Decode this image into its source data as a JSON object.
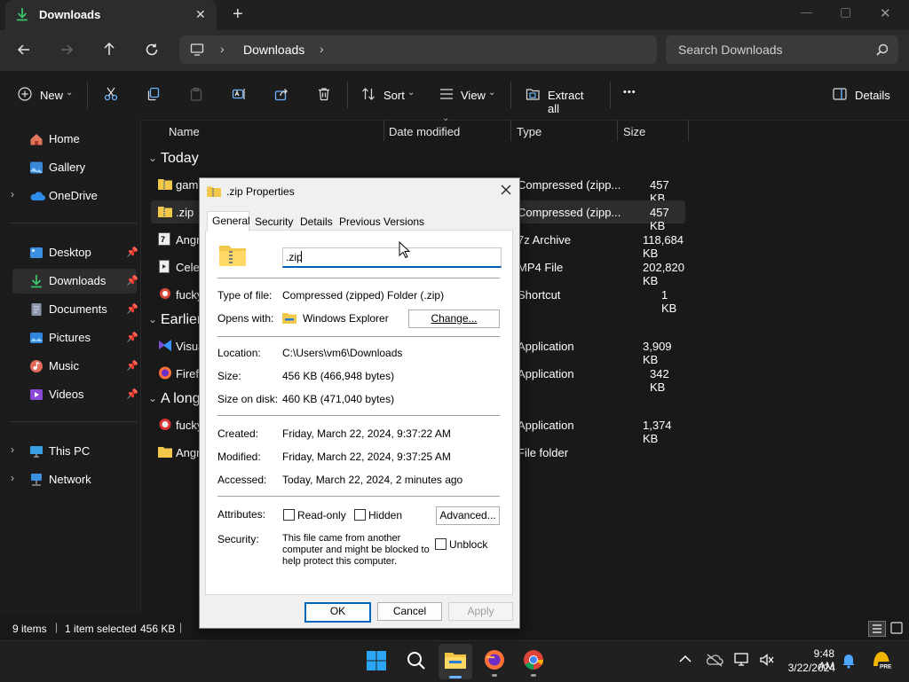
{
  "window": {
    "tab_title": "Downloads",
    "new_tab": "+",
    "controls": {
      "minimize": "—",
      "maximize": "▢",
      "close": "✕"
    }
  },
  "address": {
    "breadcrumb": "Downloads",
    "search_placeholder": "Search Downloads"
  },
  "toolbar": {
    "new": "New",
    "sort": "Sort",
    "view": "View",
    "extract_all": "Extract all",
    "more": "•••",
    "details": "Details"
  },
  "sidebar": {
    "home": "Home",
    "gallery": "Gallery",
    "onedrive": "OneDrive",
    "desktop": "Desktop",
    "downloads": "Downloads",
    "documents": "Documents",
    "pictures": "Pictures",
    "music": "Music",
    "videos": "Videos",
    "this_pc": "This PC",
    "network": "Network"
  },
  "columns": {
    "name": "Name",
    "date": "Date modified",
    "type": "Type",
    "size": "Size"
  },
  "groups": {
    "today": "Today",
    "earlier": "Earlier",
    "long_ago": "A long"
  },
  "files": [
    {
      "name": "gam",
      "type": "Compressed (zipp...",
      "size": "457 KB"
    },
    {
      "name": ".zip",
      "type": "Compressed (zipp...",
      "size": "457 KB"
    },
    {
      "name": "Angr",
      "type": "7z Archive",
      "size": "118,684 KB"
    },
    {
      "name": "Celeb",
      "type": "MP4 File",
      "size": "202,820 KB"
    },
    {
      "name": "fucky",
      "type": "Shortcut",
      "size": "1 KB"
    },
    {
      "name": "Visua",
      "type": "Application",
      "size": "3,909 KB"
    },
    {
      "name": "Firefo",
      "type": "Application",
      "size": "342 KB"
    },
    {
      "name": "fucky",
      "type": "Application",
      "size": "1,374 KB"
    },
    {
      "name": "Angr",
      "type": "File folder",
      "size": ""
    }
  ],
  "status": {
    "items": "9 items",
    "selected": "1 item selected",
    "size": "456 KB"
  },
  "dialog": {
    "title": ".zip Properties",
    "tabs": {
      "general": "General",
      "security": "Security",
      "details": "Details",
      "previous": "Previous Versions"
    },
    "filename": ".zip",
    "type_label": "Type of file:",
    "type_value": "Compressed (zipped) Folder (.zip)",
    "opens_label": "Opens with:",
    "opens_value": "Windows Explorer",
    "change_btn": "Change...",
    "location_label": "Location:",
    "location_value": "C:\\Users\\vm6\\Downloads",
    "size_label": "Size:",
    "size_value": "456 KB (466,948 bytes)",
    "disk_label": "Size on disk:",
    "disk_value": "460 KB (471,040 bytes)",
    "created_label": "Created:",
    "created_value": "Friday, March 22, 2024, 9:37:22 AM",
    "modified_label": "Modified:",
    "modified_value": "Friday, March 22, 2024, 9:37:25 AM",
    "accessed_label": "Accessed:",
    "accessed_value": "Today, March 22, 2024, 2 minutes ago",
    "attributes_label": "Attributes:",
    "readonly": "Read-only",
    "hidden": "Hidden",
    "advanced_btn": "Advanced...",
    "security_label": "Security:",
    "security_line1": "This file came from another",
    "security_line2": "computer and might be blocked to",
    "security_line3": "help protect this computer.",
    "unblock": "Unblock",
    "ok": "OK",
    "cancel": "Cancel",
    "apply": "Apply"
  },
  "taskbar": {
    "time": "9:48 AM",
    "date": "3/22/2024"
  }
}
